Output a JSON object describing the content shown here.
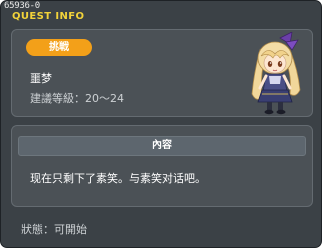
{
  "window": {
    "id_label": "65936-0",
    "title": "QUEST INFO"
  },
  "quest": {
    "type_badge": "挑戦",
    "name": "噩梦",
    "level_label": "建議等級：",
    "level_range": "20～24"
  },
  "content": {
    "header": "內容",
    "text": "现在只剩下了素笑。与素笑对话吧。"
  },
  "status": {
    "label": "狀態：",
    "value": "可開始"
  },
  "colors": {
    "title": "#f2d33a",
    "badge": "#f3a019",
    "panel": "#4b5156",
    "window": "#3b4146"
  },
  "npc": {
    "icon": "npc-portrait-blonde-girl"
  }
}
